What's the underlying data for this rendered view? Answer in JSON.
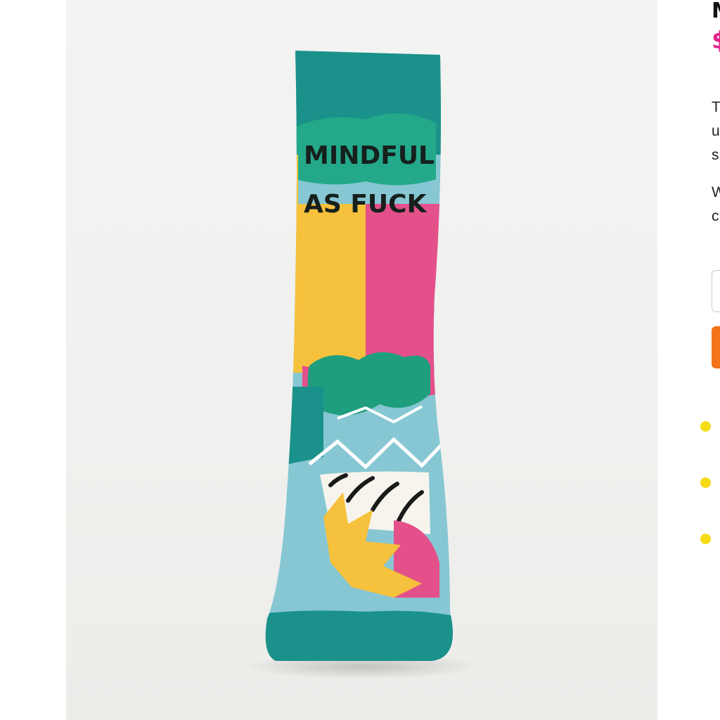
{
  "product": {
    "image_alt": "Mindful As Fuck Women's Ankle Socks",
    "sock_text_line1": "MINDFUL",
    "sock_text_line2": "AS FUCK",
    "title": "M",
    "price": "$",
    "description": [
      "T",
      "u",
      "s"
    ],
    "note": [
      "W",
      "c"
    ]
  },
  "purchase": {
    "quantity_value": "",
    "add_to_cart_label": ""
  },
  "features": [
    "",
    "",
    ""
  ],
  "colors": {
    "teal": "#1a918a",
    "mint": "#23a88a",
    "yellow": "#f6c13d",
    "pink": "#e4508a",
    "light_blue": "#86c7d3",
    "price_pink": "#e4248a",
    "button_orange": "#f27318",
    "bullet_yellow": "#f5dc16"
  }
}
